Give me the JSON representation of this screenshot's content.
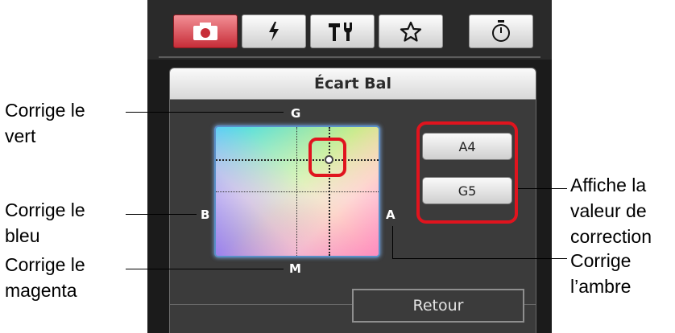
{
  "tabs": [
    {
      "icon": "camera-icon",
      "active": true
    },
    {
      "icon": "flash-icon",
      "active": false
    },
    {
      "icon": "tools-icon",
      "active": false
    },
    {
      "icon": "star-icon",
      "active": false
    },
    {
      "icon": "timer-icon",
      "active": false
    }
  ],
  "dialog": {
    "title": "Écart Bal",
    "axis": {
      "top": "G",
      "left": "B",
      "right": "A",
      "bottom": "M"
    },
    "values": {
      "first": "A4",
      "second": "G5"
    },
    "back_label": "Retour"
  },
  "callouts": {
    "green": [
      "Corrige le",
      "vert"
    ],
    "blue": [
      "Corrige le",
      "bleu"
    ],
    "magenta": [
      "Corrige le",
      "magenta"
    ],
    "value": [
      "Affiche la",
      "valeur de",
      "correction"
    ],
    "amber": [
      "Corrige",
      "l’ambre"
    ]
  },
  "colors": {
    "highlight": "#e0141e",
    "active_tab": "#d83a45"
  }
}
